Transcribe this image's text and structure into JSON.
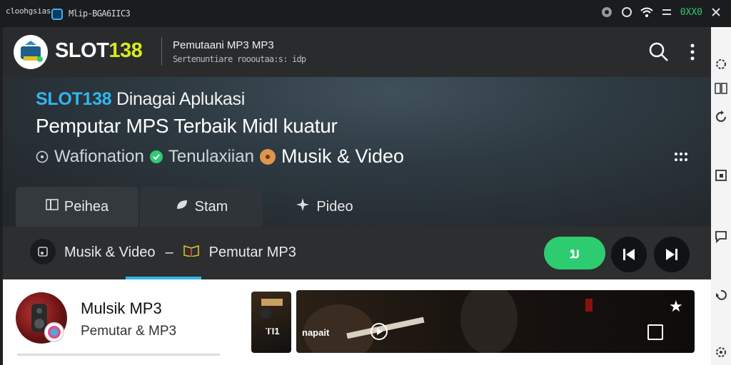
{
  "statusbar": {
    "left_text": "cloohgsias",
    "app_title": "Mlip-BGA6IIC3",
    "battery": "0XX0"
  },
  "topbar": {
    "brand_white": "SLOT",
    "brand_yellow": "138",
    "title": "Pemutaani MP3 MP3",
    "subtitle": "Sertenuntiare roooutaa:s: idp"
  },
  "hero": {
    "line1_brand": "SLOT138",
    "line1_rest": "Dinagai Aplukasi",
    "line2": "Pemputar MPS Terbaik Midl kuatur",
    "chips": [
      {
        "label": "Wafionation"
      },
      {
        "label": "Tenulaxiian"
      },
      {
        "label": "Musik & Video"
      }
    ]
  },
  "tabs": [
    {
      "label": "Peihea"
    },
    {
      "label": "Stam"
    },
    {
      "label": "Pideo"
    }
  ],
  "player": {
    "left_label": "Musik & Video",
    "separator": "–",
    "right_label": "Pemutar MP3",
    "green_button": "ນ"
  },
  "card": {
    "title": "Mulsik MP3",
    "subtitle": "Pemutar & MP3",
    "thumb_text": "ΊΊ1",
    "video_label": "napait"
  },
  "colors": {
    "accent_blue": "#2fb6f0",
    "accent_green": "#2ecc71",
    "brand_yellow": "#d8ea1e"
  }
}
